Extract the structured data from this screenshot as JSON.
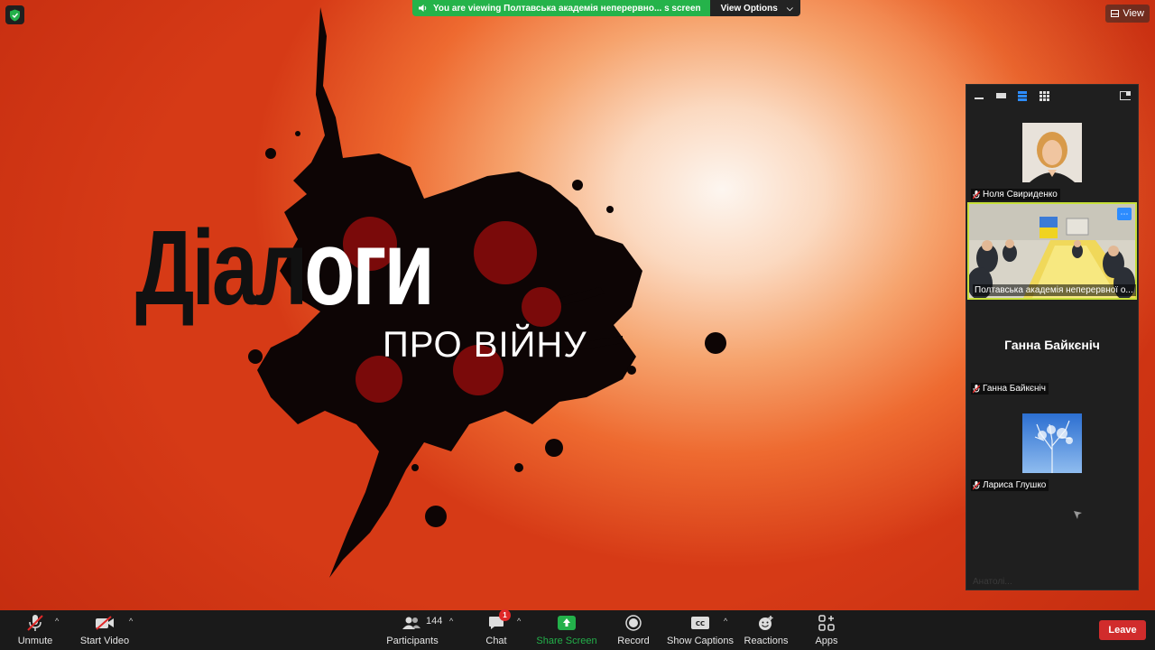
{
  "colors": {
    "banner_green": "#25b34a",
    "leave_red": "#d12c2c",
    "share_green": "#23b04a",
    "active_tile_border": "#c7df3a"
  },
  "banner": {
    "viewing_text": "You are viewing Полтавська академія неперервно... s screen",
    "view_options_label": "View Options"
  },
  "view_button": {
    "label": "View"
  },
  "slide": {
    "title_black": "Діа",
    "title_mid_black": "л",
    "title_white": "оги",
    "subtitle": "ПРО ВІЙНУ"
  },
  "panel": {
    "tiles": [
      {
        "name": "Ноля Свириденко",
        "muted": true,
        "type": "photo"
      },
      {
        "name": "Полтавська академія неперервної о...",
        "muted": false,
        "type": "video",
        "more_icon": "more-icon"
      },
      {
        "name": "Ганна Байкєніч",
        "display_name": "Ганна Байкєніч",
        "muted": true,
        "type": "name"
      },
      {
        "name": "Лариса Глушко",
        "muted": true,
        "type": "photo"
      },
      {
        "name": "Анатолі...",
        "muted": true,
        "type": "hidden"
      }
    ]
  },
  "toolbar": {
    "unmute": "Unmute",
    "start_video": "Start Video",
    "participants": "Participants",
    "participants_count": "144",
    "chat": "Chat",
    "chat_badge": "1",
    "share_screen": "Share Screen",
    "record": "Record",
    "show_captions": "Show Captions",
    "reactions": "Reactions",
    "apps": "Apps",
    "leave": "Leave"
  }
}
